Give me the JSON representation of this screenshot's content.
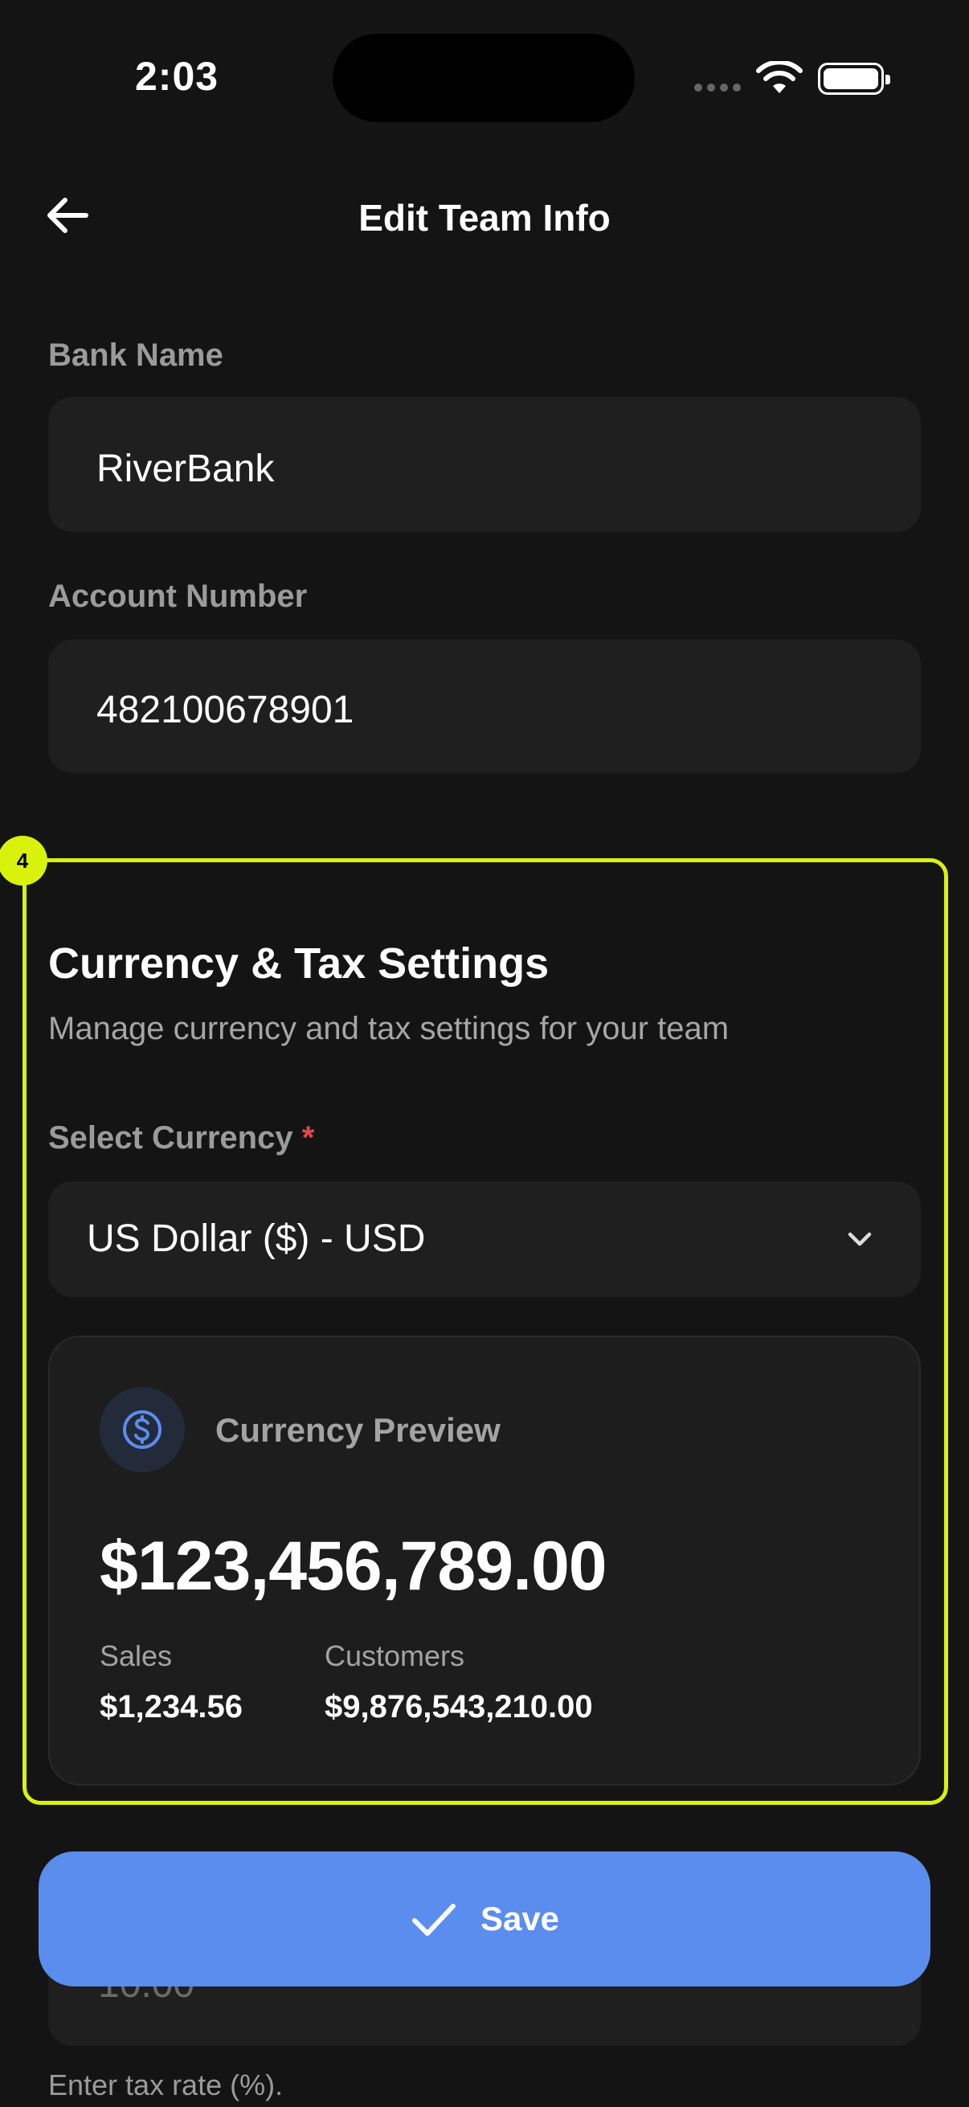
{
  "status_bar": {
    "time": "2:03"
  },
  "header": {
    "title": "Edit Team Info",
    "back_icon": "arrow-left-icon"
  },
  "bank_name": {
    "label": "Bank Name",
    "value": "RiverBank"
  },
  "account_number": {
    "label": "Account Number",
    "value": "482100678901"
  },
  "highlight": {
    "badge": "4",
    "color": "#d8f20c"
  },
  "currency_section": {
    "title": "Currency & Tax Settings",
    "subtitle": "Manage currency and tax settings for your team",
    "select_label": "Select Currency",
    "required_mark": "*",
    "selected_currency": "US Dollar ($) - USD",
    "preview": {
      "label": "Currency Preview",
      "amount": "$123,456,789.00",
      "sales_label": "Sales",
      "sales_value": "$1,234.56",
      "customers_label": "Customers",
      "customers_value": "$9,876,543,210.00"
    }
  },
  "tax": {
    "value": "10.00",
    "helper": "Enter tax rate (%)."
  },
  "save_button": {
    "label": "Save",
    "icon": "check-icon",
    "color": "#5b8def"
  }
}
